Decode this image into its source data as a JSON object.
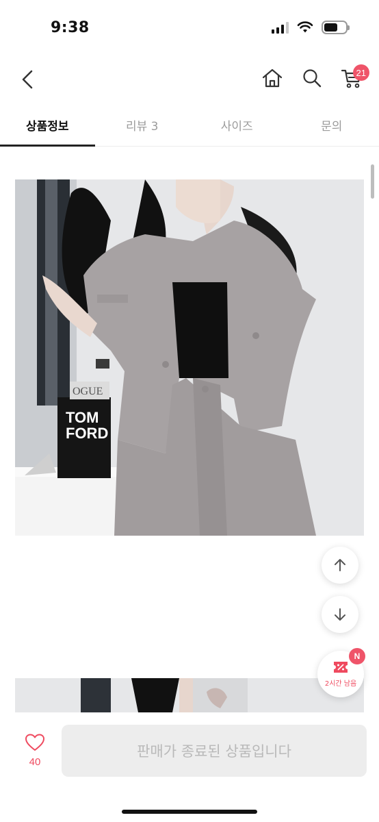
{
  "status_bar": {
    "time": "9:38",
    "battery_level": 0.62
  },
  "header": {
    "back_icon": "chevron-left-icon",
    "home_icon": "home-icon",
    "search_icon": "search-icon",
    "cart_icon": "cart-icon",
    "cart_count": "21"
  },
  "tabs": [
    {
      "label": "상품정보",
      "active": true
    },
    {
      "label": "리뷰 3",
      "active": false
    },
    {
      "label": "사이즈",
      "active": false
    },
    {
      "label": "문의",
      "active": false
    }
  ],
  "product_image": {
    "book_text_line1": "TOM",
    "book_text_line2": "FORD",
    "magazine_text": "OGUE"
  },
  "floating": {
    "scroll_up_icon": "arrow-up-icon",
    "scroll_down_icon": "arrow-down-icon",
    "coupon_icon": "coupon-icon",
    "coupon_badge": "N",
    "coupon_text": "2시간 남음"
  },
  "bottom_bar": {
    "like_icon": "heart-icon",
    "like_count": "40",
    "sold_out_label": "판매가 종료된 상품입니다"
  },
  "colors": {
    "accent": "#ef5469",
    "tab_active": "#222222",
    "disabled_bg": "#ededed"
  }
}
